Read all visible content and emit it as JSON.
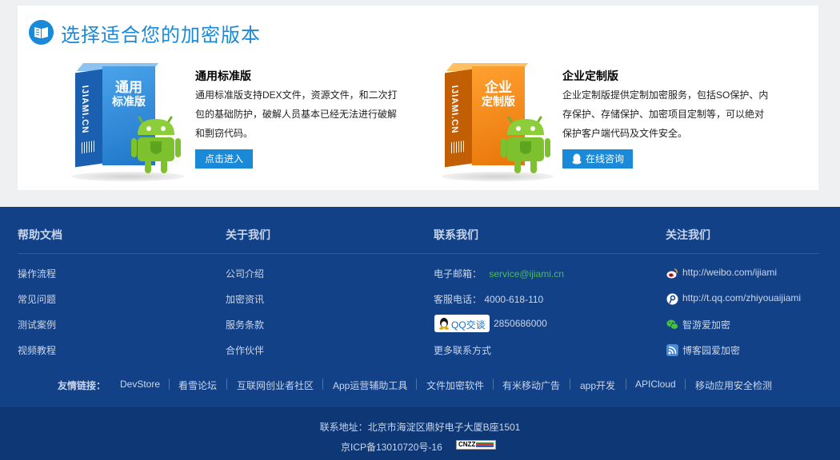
{
  "section": {
    "title": "选择适合您的加密版本"
  },
  "products": [
    {
      "box_line1": "通用",
      "box_line2": "标准版",
      "box_side": "IJIAMI.CN",
      "title": "通用标准版",
      "desc_lines": [
        "通用标准版支持DEX文件，资源文件，和二次打",
        "包的基础防护，破解人员基本已经无法进行破解",
        "和剽窃代码。"
      ],
      "button": "点击进入",
      "colors": {
        "front": "#2a86d8",
        "side": "#1a5fb0",
        "top": "#8cc3f0"
      }
    },
    {
      "box_line1": "企业",
      "box_line2": "定制版",
      "box_side": "IJIAMI.CN",
      "title": "企业定制版",
      "desc_lines": [
        "企业定制版提供定制加密服务，包括SO保护、内",
        "存保护、存储保护、加密项目定制等，可以绝对",
        "保护客户端代码及文件安全。"
      ],
      "button": "在线咨询",
      "colors": {
        "front": "#f08a10",
        "side": "#c25f05",
        "top": "#ffc063"
      }
    }
  ],
  "footer": {
    "columns": [
      {
        "heading": "帮助文档",
        "items": [
          "操作流程",
          "常见问题",
          "测试案例",
          "视频教程"
        ]
      },
      {
        "heading": "关于我们",
        "items": [
          "公司介绍",
          "加密资讯",
          "服务条款",
          "合作伙伴"
        ]
      },
      {
        "heading": "联系我们"
      },
      {
        "heading": "关注我们"
      }
    ],
    "contact": {
      "email_label": "电子邮箱：",
      "email": "service@ijiami.cn",
      "phone_label": "客服电话：",
      "phone": "4000-618-110",
      "qq_badge": "QQ交谈",
      "qq_number": "2850686000",
      "more": "更多联系方式"
    },
    "follow": [
      {
        "icon": "weibo-icon",
        "text": "http://weibo.com/ijiami"
      },
      {
        "icon": "tencent-weibo-icon",
        "text": "http://t.qq.com/zhiyouaijiami"
      },
      {
        "icon": "wechat-icon",
        "text": "智游爱加密"
      },
      {
        "icon": "rss-icon",
        "text": "博客园爱加密"
      }
    ],
    "friend_label": "友情链接：",
    "friends": [
      "DevStore",
      "看雪论坛",
      "互联网创业者社区",
      "App运营辅助工具",
      "文件加密软件",
      "有米移动广告",
      "app开发",
      "APICloud",
      "移动应用安全检测"
    ],
    "address": "联系地址：北京市海淀区鼎好电子大厦B座1501",
    "icp": "京ICP备13010720号-16",
    "cnzz": "CNZZ"
  }
}
